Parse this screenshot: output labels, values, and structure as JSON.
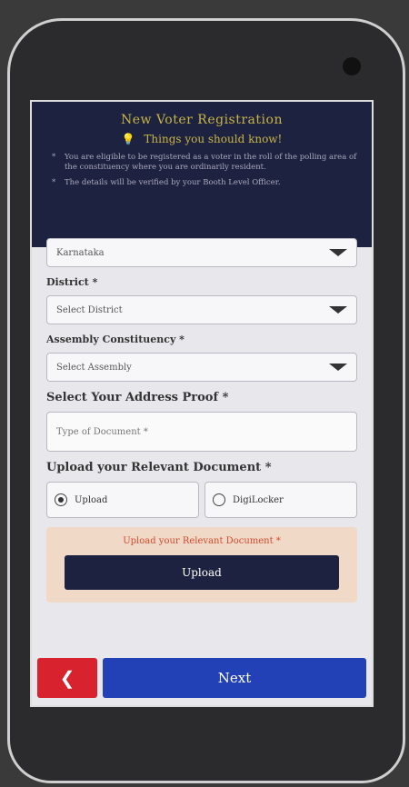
{
  "header": {
    "title": "New Voter Registration",
    "subtitle": "Things you should know!",
    "notes": [
      "You are eligible to be registered as a voter in the roll of the polling area of the constituency where you are ordinarily resident.",
      "The details will be verified by your Booth Level Officer."
    ]
  },
  "form": {
    "state_value": "Karnataka",
    "district_label": "District *",
    "district_value": "Select District",
    "assembly_label": "Assembly Constituency *",
    "assembly_value": "Select Assembly",
    "address_proof_label": "Select Your Address Proof *",
    "address_proof_placeholder": "Type of Document *",
    "upload_doc_label": "Upload your Relevant Document *",
    "radio_upload": "Upload",
    "radio_digilocker": "DigiLocker",
    "upload_hint": "Upload your Relevant Document *",
    "upload_button": "Upload"
  },
  "footer": {
    "back_icon": "chevron-left-icon",
    "next_label": "Next"
  }
}
